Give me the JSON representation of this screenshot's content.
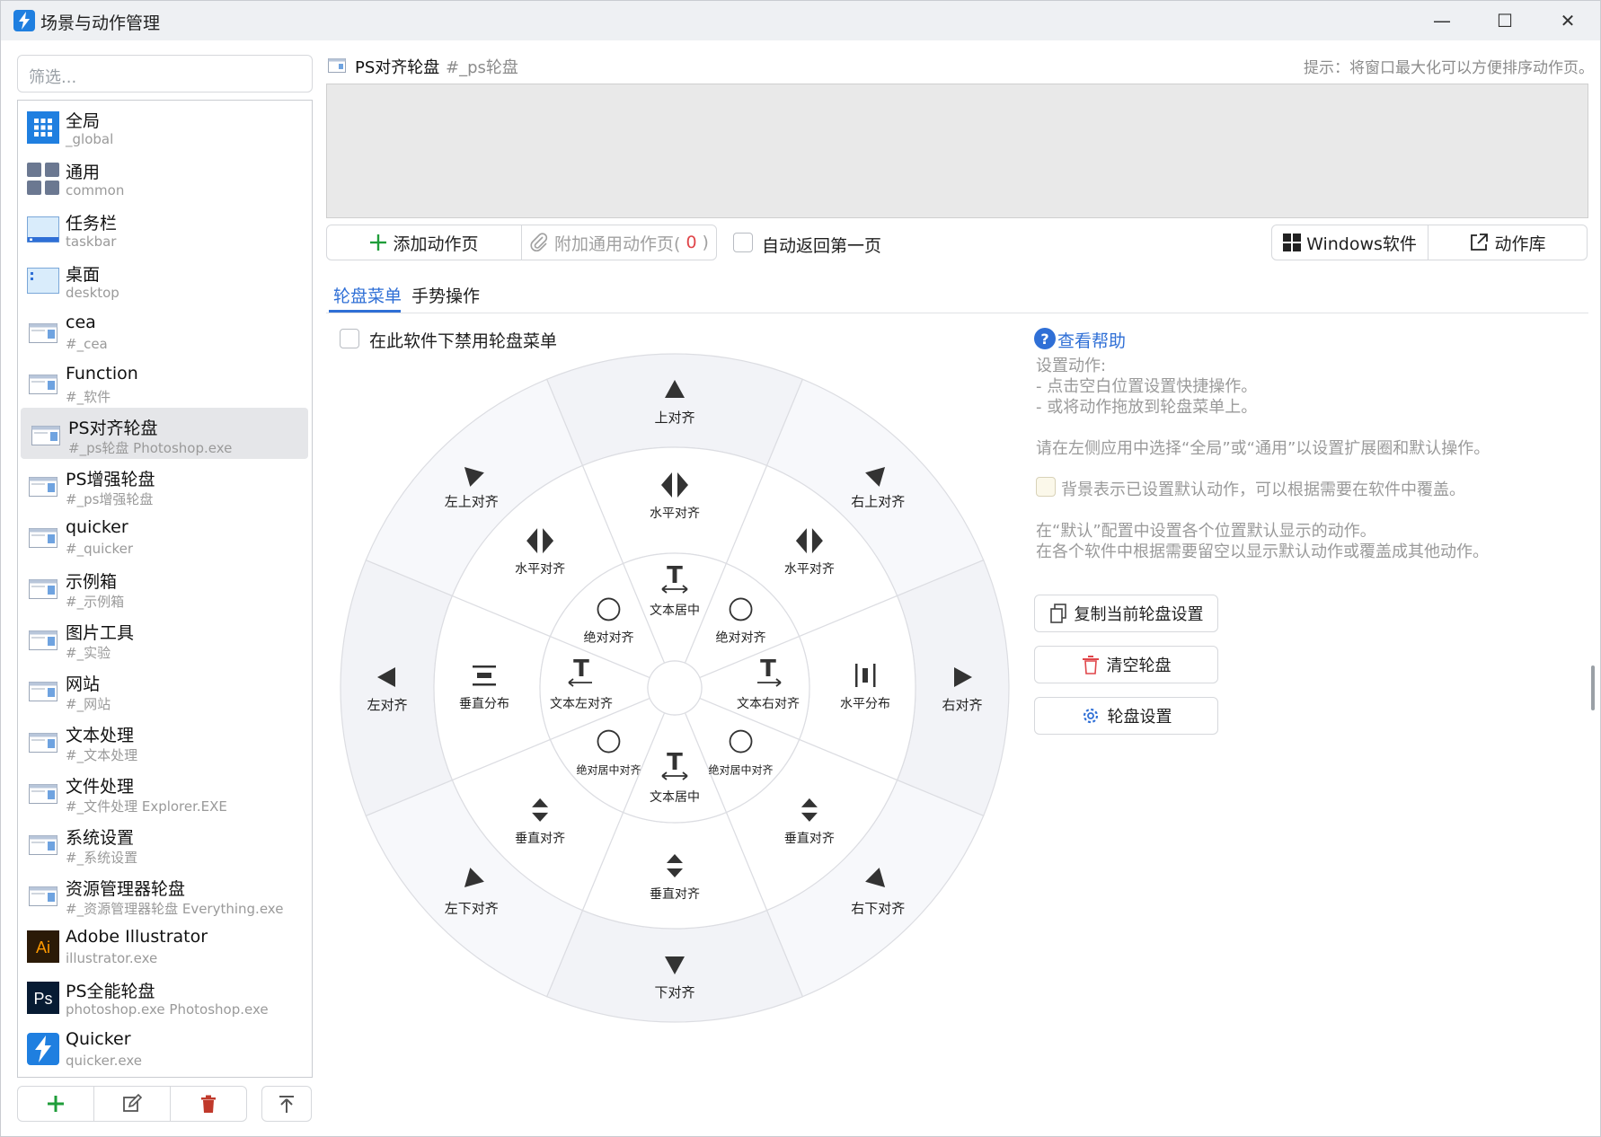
{
  "window": {
    "title": "场景与动作管理",
    "minimize": "—",
    "maximize": "☐",
    "close": "✕"
  },
  "sidebar": {
    "filter_placeholder": "筛选...",
    "items": [
      {
        "name": "全局",
        "sub": "_global",
        "icon": "grid-icon"
      },
      {
        "name": "通用",
        "sub": "common",
        "icon": "tiles-icon"
      },
      {
        "name": "任务栏",
        "sub": "taskbar",
        "icon": "taskbar-icon"
      },
      {
        "name": "桌面",
        "sub": "desktop",
        "icon": "desktop-icon"
      },
      {
        "name": "cea",
        "sub": "#_cea",
        "icon": "window-icon"
      },
      {
        "name": "Function",
        "sub": "#_软件",
        "icon": "window-icon"
      },
      {
        "name": "PS对齐轮盘",
        "sub": "#_ps轮盘  Photoshop.exe",
        "icon": "window-icon",
        "selected": true
      },
      {
        "name": "PS增强轮盘",
        "sub": "#_ps增强轮盘",
        "icon": "window-icon"
      },
      {
        "name": "quicker",
        "sub": "#_quicker",
        "icon": "window-icon"
      },
      {
        "name": "示例箱",
        "sub": "#_示例箱",
        "icon": "window-icon"
      },
      {
        "name": "图片工具",
        "sub": "#_实验",
        "icon": "window-icon"
      },
      {
        "name": "网站",
        "sub": "#_网站",
        "icon": "window-icon"
      },
      {
        "name": "文本处理",
        "sub": "#_文本处理",
        "icon": "window-icon"
      },
      {
        "name": "文件处理",
        "sub": "#_文件处理  Explorer.EXE",
        "icon": "window-icon"
      },
      {
        "name": "系统设置",
        "sub": "#_系统设置",
        "icon": "window-icon"
      },
      {
        "name": "资源管理器轮盘",
        "sub": "#_资源管理器轮盘  Everything.exe",
        "icon": "window-icon"
      },
      {
        "name": "Adobe Illustrator",
        "sub": "illustrator.exe",
        "icon": "illustrator-icon",
        "icon_text": "Ai"
      },
      {
        "name": "PS全能轮盘",
        "sub": "photoshop.exe  Photoshop.exe",
        "icon": "photoshop-icon",
        "icon_text": "Ps"
      },
      {
        "name": "Quicker",
        "sub": "quicker.exe",
        "icon": "quicker-icon"
      }
    ]
  },
  "header": {
    "title": "PS对齐轮盘",
    "id": "#_ps轮盘",
    "hint": "提示：将窗口最大化可以方便排序动作页。"
  },
  "toolbar": {
    "add_page": "添加动作页",
    "attach_common": "附加通用动作页(",
    "attach_count": "0",
    "attach_close": ")",
    "auto_return": "自动返回第一页",
    "windows_soft": "Windows软件",
    "action_lib": "动作库"
  },
  "tabs": {
    "wheel": "轮盘菜单",
    "gesture": "手势操作"
  },
  "wheel_panel": {
    "disable_label": "在此软件下禁用轮盘菜单",
    "outer": [
      "上对齐",
      "右上对齐",
      "右对齐",
      "右下对齐",
      "下对齐",
      "左下对齐",
      "左对齐",
      "左上对齐"
    ],
    "middle": [
      "水平对齐",
      "水平对齐",
      "水平分布",
      "垂直对齐",
      "垂直对齐",
      "垂直对齐",
      "垂直分布",
      "水平对齐"
    ],
    "inner": [
      "文本居中",
      "绝对对齐",
      "文本右对齐",
      "绝对居中对齐",
      "文本居中",
      "绝对居中对齐",
      "文本左对齐",
      "绝对对齐"
    ]
  },
  "help": {
    "link": "查看帮助",
    "setup_title": "设置动作:",
    "setup_1": "- 点击空白位置设置快捷操作。",
    "setup_2": "- 或将动作拖放到轮盘菜单上。",
    "note_1": "请在左侧应用中选择“全局”或“通用”以设置扩展圈和默认操作。",
    "bg_note": "背景表示已设置默认动作，可以根据需要在软件中覆盖。",
    "default_1": "在“默认”配置中设置各个位置默认显示的动作。",
    "default_2": "在各个软件中根据需要留空以显示默认动作或覆盖成其他动作。",
    "copy_btn": "复制当前轮盘设置",
    "clear_btn": "清空轮盘",
    "settings_btn": "轮盘设置"
  },
  "colors": {
    "accent": "#2f6fd6",
    "add_green": "#1f9d3a",
    "delete_red": "#c0392b",
    "count_red": "#e0464a"
  }
}
